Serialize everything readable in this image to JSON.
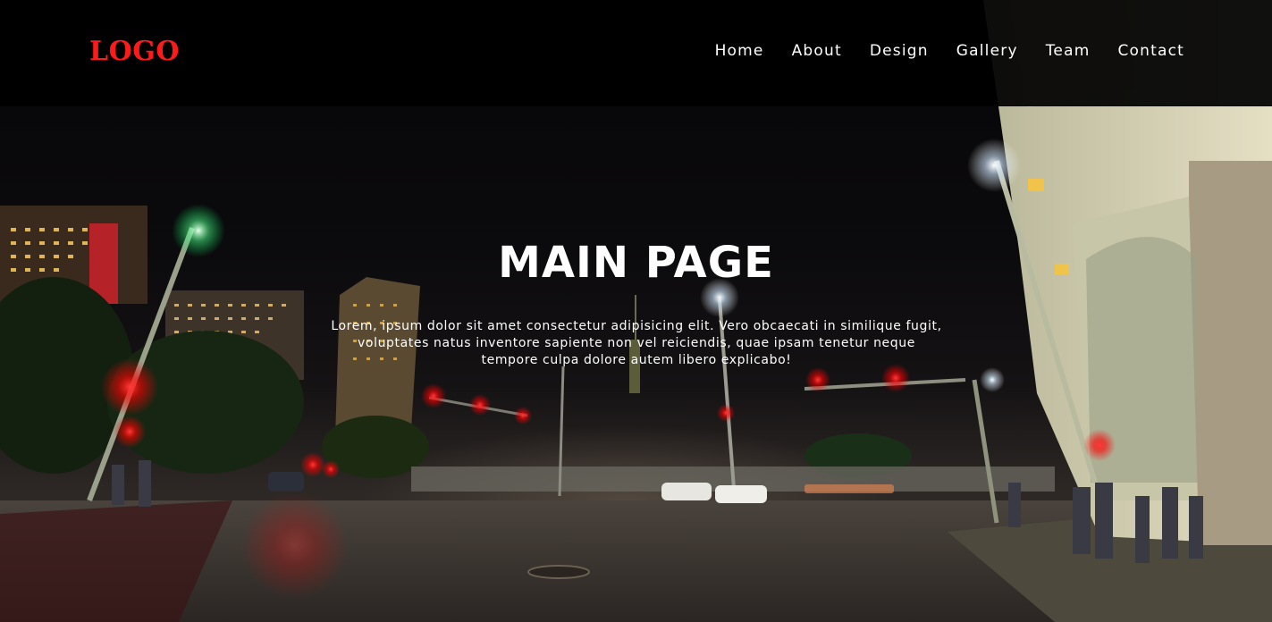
{
  "navbar": {
    "logo": "LOGO",
    "items": [
      {
        "label": "Home"
      },
      {
        "label": "About"
      },
      {
        "label": "Design"
      },
      {
        "label": "Gallery"
      },
      {
        "label": "Team"
      },
      {
        "label": "Contact"
      }
    ]
  },
  "hero": {
    "title": "MAIN PAGE",
    "description": "Lorem, ipsum dolor sit amet consectetur adipisicing elit. Vero obcaecati in similique fugit, voluptates natus inventore sapiente non vel reiciendis, quae ipsam tenetur neque tempore culpa dolore autem libero explicabo!"
  },
  "colors": {
    "logo": "#ff1a1a",
    "nav_text": "#ffffff",
    "navbar_bg": "#000000"
  }
}
